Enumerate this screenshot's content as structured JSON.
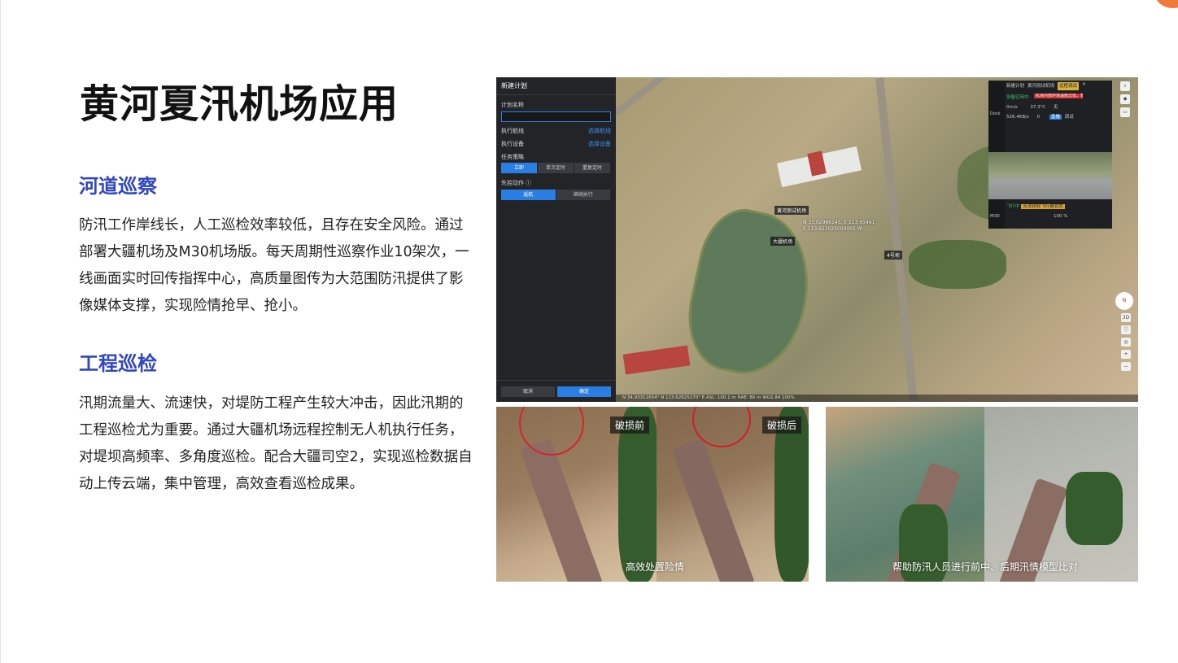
{
  "page": {
    "title": "黄河夏汛机场应用"
  },
  "sections": [
    {
      "heading": "河道巡察",
      "body": "防汛工作岸线长，人工巡检效率较低，且存在安全风险。通过部署大疆机场及M30机场版。每天周期性巡察作业10架次，一线画面实时回传指挥中心，高质量图传为大范围防汛提供了影像媒体支撑，实现险情抢早、抢小。"
    },
    {
      "heading": "工程巡检",
      "body": "汛期流量大、流速快，对堤防工程产生较大冲击，因此汛期的工程巡检尤为重要。通过大疆机场远程控制无人机执行任务，对堤坝高频率、多角度巡检。配合大疆司空2，实现巡检数据自动上传云端，集中管理，高效查看巡检成果。"
    }
  ],
  "screenshot": {
    "plan_panel": {
      "header": "新建计划",
      "plan_name_label": "计划名称",
      "aircraft_label": "执行航线",
      "aircraft_link": "选择航线",
      "device_label": "执行设备",
      "device_link": "选择设备",
      "strategy_label": "任务策略",
      "strategy_options": [
        "立即",
        "单次定时",
        "重复定时"
      ],
      "strategy_selected": "立即",
      "lost_action_label": "失控动作 ⓘ",
      "lost_action_options": [
        "返航",
        "继续执行"
      ],
      "lost_action_selected": "返航",
      "cancel": "取消",
      "confirm": "确定"
    },
    "map": {
      "marker_label": "黄河测试机场",
      "dock_name": "大疆机场",
      "coord1": "N 35.02986145, E 113.65491",
      "coord2": "E 113.652025000001 W",
      "poi_label": "4号坝",
      "dock_panel": {
        "tab1": "新建计划",
        "tab2": "黄河测试机场",
        "tab_btn": "远程调试",
        "side_label": "Dock",
        "status_green": "设备空闲中",
        "status_red": "机场内部环境温度过低，暂停作业",
        "wind": "0m/s",
        "temp": "37.3°C",
        "rain": "无",
        "network": "526.4KB/s",
        "storage": "0",
        "btn_live": "直播",
        "btn_debug": "调试",
        "aircraft_status": "飞行中",
        "aircraft_warning": "无法获取飞行器状态",
        "aircraft_label": "M30",
        "battery": "100 %"
      },
      "tools": {
        "compass": "N",
        "mode_3d": "3D"
      },
      "statusbar": "N 34.93311654° N   113.62625270° E   ASL: 100.1 m   HAE: 80 m   WGS 84   100%"
    }
  },
  "photos": [
    {
      "tag_before": "破损前",
      "tag_after": "破损后",
      "caption": "高效处置险情"
    },
    {
      "caption": "帮助防汛人员进行前中、后期汛情模型比对"
    }
  ],
  "colors": {
    "heading": "#2f47c2",
    "accent": "#f07a3a",
    "primary_button": "#2a7de1",
    "alert_red": "#d8232a"
  }
}
